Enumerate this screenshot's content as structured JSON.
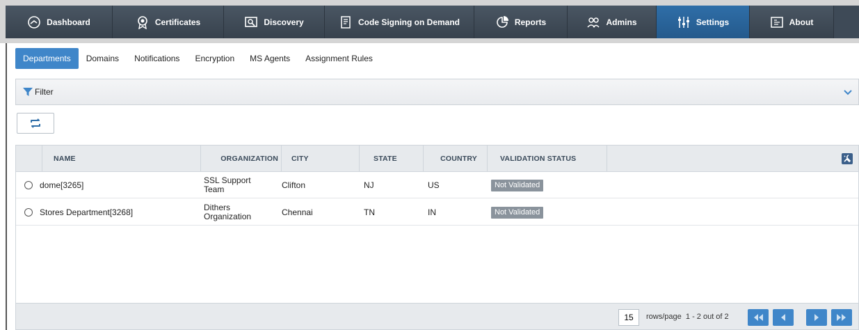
{
  "nav": {
    "items": [
      {
        "label": "Dashboard",
        "icon": "dashboard-icon"
      },
      {
        "label": "Certificates",
        "icon": "certificate-icon"
      },
      {
        "label": "Discovery",
        "icon": "discovery-icon"
      },
      {
        "label": "Code Signing on Demand",
        "icon": "code-signing-icon"
      },
      {
        "label": "Reports",
        "icon": "reports-icon"
      },
      {
        "label": "Admins",
        "icon": "admins-icon"
      },
      {
        "label": "Settings",
        "icon": "settings-sliders-icon"
      },
      {
        "label": "About",
        "icon": "about-icon"
      }
    ],
    "active": "Settings",
    "active_color": "#2f6ea8"
  },
  "subtabs": {
    "items": [
      "Departments",
      "Domains",
      "Notifications",
      "Encryption",
      "MS Agents",
      "Assignment Rules"
    ],
    "active": "Departments",
    "active_color": "#3f86c9"
  },
  "filter": {
    "label": "Filter"
  },
  "table": {
    "columns": [
      "NAME",
      "ORGANIZATION",
      "CITY",
      "STATE",
      "COUNTRY",
      "VALIDATION STATUS"
    ],
    "rows": [
      {
        "name": "dome[3265]",
        "organization": "SSL Support Team",
        "city": "Clifton",
        "state": "NJ",
        "country": "US",
        "status": "Not Validated"
      },
      {
        "name": "Stores Department[3268]",
        "organization": "Dithers Organization",
        "city": "Chennai",
        "state": "TN",
        "country": "IN",
        "status": "Not Validated"
      }
    ]
  },
  "pagination": {
    "rows_per_page": "15",
    "rows_label": "rows/page",
    "range_text": "1 - 2 out of 2"
  }
}
